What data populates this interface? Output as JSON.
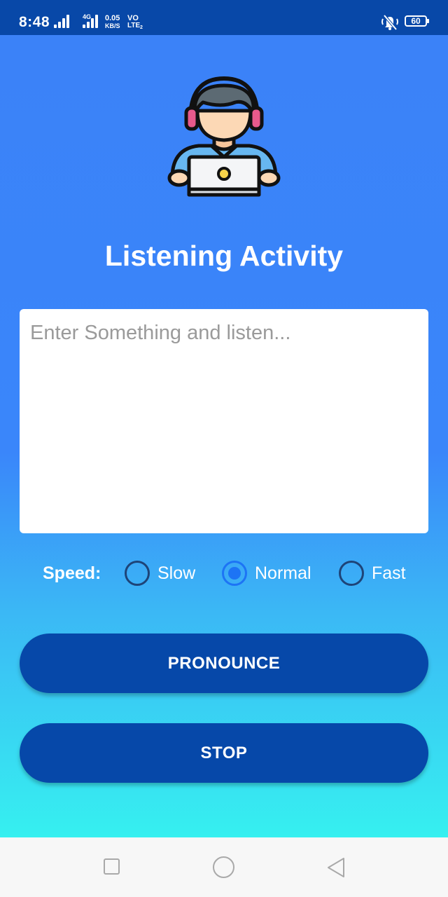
{
  "status_bar": {
    "time": "8:48",
    "network_label": "4G",
    "speed_value": "0.05",
    "speed_unit": "KB/S",
    "volte_top": "VO",
    "volte_bottom": "LTE",
    "volte_sim": "2",
    "battery": "60"
  },
  "main": {
    "title": "Listening Activity",
    "input_placeholder": "Enter Something and listen...",
    "input_value": "",
    "speed_label": "Speed:",
    "speed_options": [
      {
        "label": "Slow",
        "selected": false
      },
      {
        "label": "Normal",
        "selected": true
      },
      {
        "label": "Fast",
        "selected": false
      }
    ],
    "pronounce_label": "PRONOUNCE",
    "stop_label": "STOP"
  },
  "colors": {
    "status_bar": "#0848a8",
    "gradient_top": "#3b82f8",
    "gradient_bottom": "#36f0f0",
    "button": "#0648a9",
    "radio_selected": "#1d74f5"
  },
  "icons": [
    "signal-icon",
    "mute-icon",
    "battery-icon",
    "user-headphones-laptop-illustration",
    "recents-icon",
    "home-icon",
    "back-icon"
  ]
}
